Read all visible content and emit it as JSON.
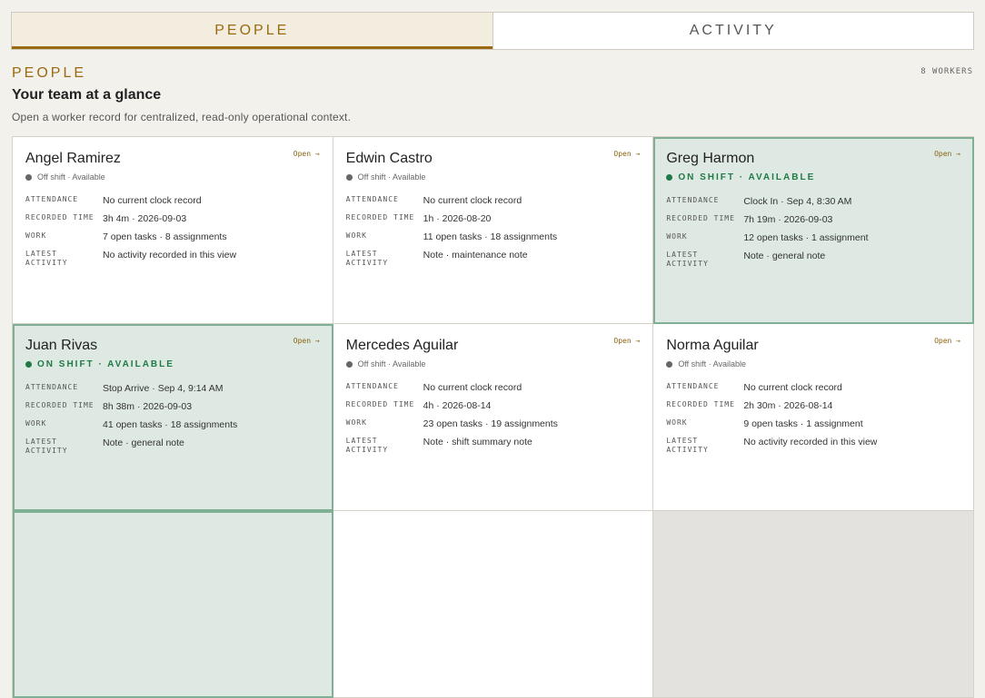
{
  "tabs": [
    {
      "label": "PEOPLE",
      "active": true
    },
    {
      "label": "ACTIVITY",
      "active": false
    }
  ],
  "section": {
    "label": "PEOPLE",
    "count": "8 WORKERS",
    "headline": "Your team at a glance",
    "subline": "Open a worker record for centralized, read-only operational context."
  },
  "labels": {
    "open": "Open →",
    "attendance": "ATTENDANCE",
    "recorded_time": "RECORDED TIME",
    "work": "WORK",
    "latest_activity": "LATEST ACTIVITY"
  },
  "workers": [
    {
      "name": "Angel Ramirez",
      "status": "Off shift · Available",
      "on_shift": false,
      "attendance": "No current clock record",
      "recorded_time": "3h 4m · 2026-09-03",
      "work": "7 open tasks · 8 assignments",
      "latest_activity": "No activity recorded in this view"
    },
    {
      "name": "Edwin Castro",
      "status": "Off shift · Available",
      "on_shift": false,
      "attendance": "No current clock record",
      "recorded_time": "1h · 2026-08-20",
      "work": "11 open tasks · 18 assignments",
      "latest_activity": "Note · maintenance note"
    },
    {
      "name": "Greg Harmon",
      "status": "ON SHIFT · AVAILABLE",
      "on_shift": true,
      "attendance": "Clock In · Sep 4, 8:30 AM",
      "recorded_time": "7h 19m · 2026-09-03",
      "work": "12 open tasks · 1 assignment",
      "latest_activity": "Note · general note"
    },
    {
      "name": "Juan Rivas",
      "status": "ON SHIFT · AVAILABLE",
      "on_shift": true,
      "attendance": "Stop Arrive · Sep 4, 9:14 AM",
      "recorded_time": "8h 38m · 2026-09-03",
      "work": "41 open tasks · 18 assignments",
      "latest_activity": "Note · general note"
    },
    {
      "name": "Mercedes Aguilar",
      "status": "Off shift · Available",
      "on_shift": false,
      "attendance": "No current clock record",
      "recorded_time": "4h · 2026-08-14",
      "work": "23 open tasks · 19 assignments",
      "latest_activity": "Note · shift summary note"
    },
    {
      "name": "Norma Aguilar",
      "status": "Off shift · Available",
      "on_shift": false,
      "attendance": "No current clock record",
      "recorded_time": "2h 30m · 2026-08-14",
      "work": "9 open tasks · 1 assignment",
      "latest_activity": "No activity recorded in this view"
    }
  ],
  "colors": {
    "accent": "#9a6a10",
    "on_shift": "#1f7a46",
    "on_shift_bg": "#dde9e2"
  }
}
